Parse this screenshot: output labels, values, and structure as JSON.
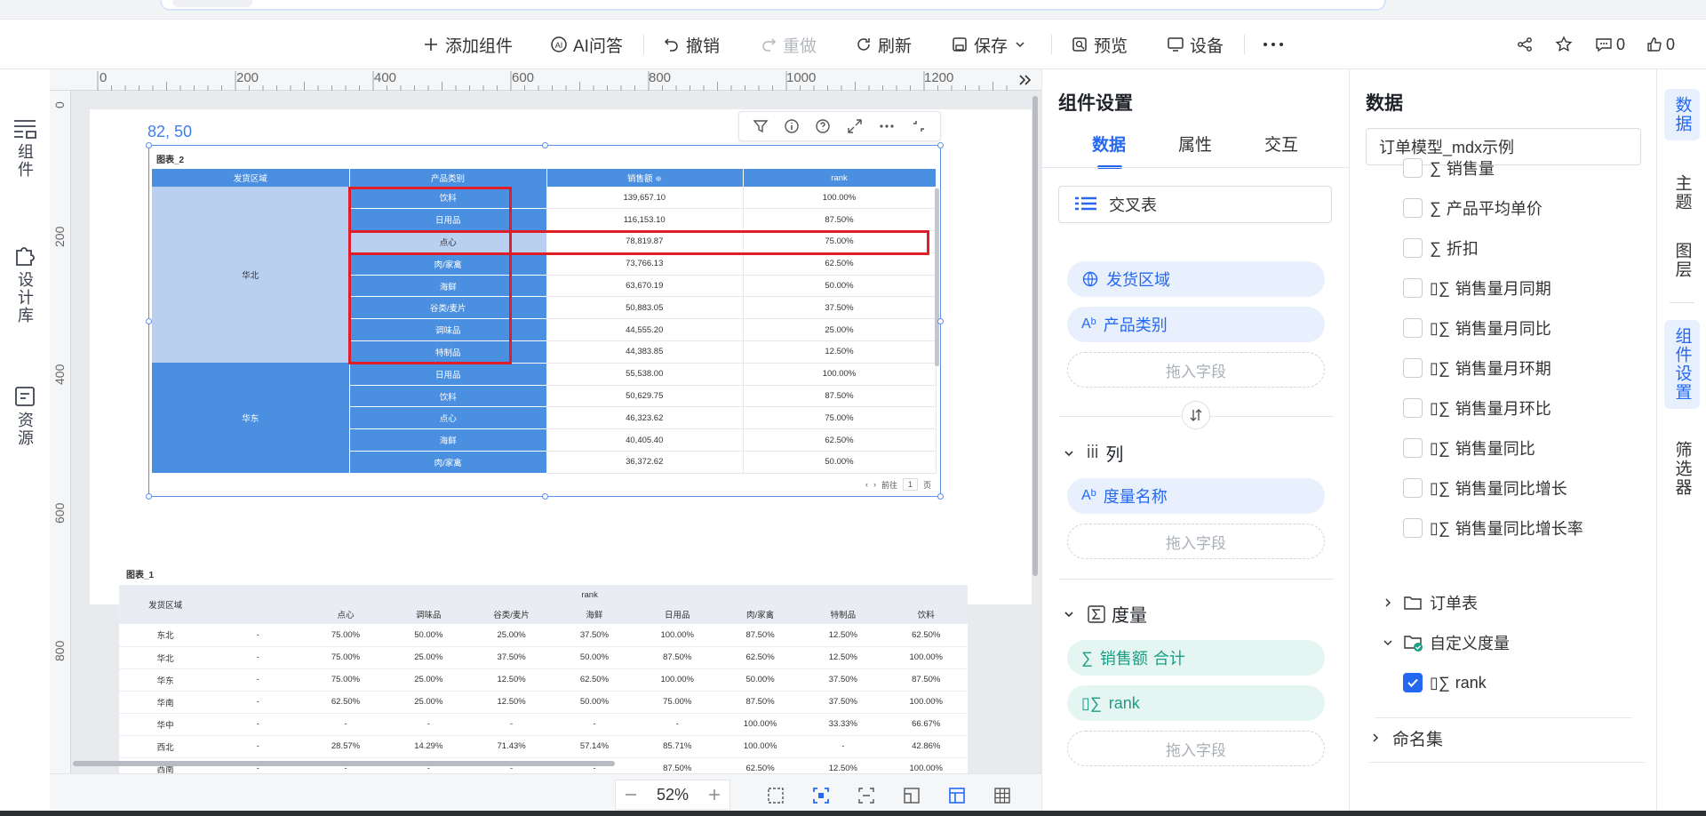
{
  "toolbar": {
    "add_component": "添加组件",
    "ai_qa": "AI问答",
    "undo": "撤销",
    "redo": "重做",
    "refresh": "刷新",
    "save": "保存",
    "preview": "预览",
    "device": "设备",
    "comments_count": "0",
    "likes_count": "0"
  },
  "leftnav": {
    "components": "组件",
    "design_library": "设计库",
    "resources": "资源"
  },
  "ruler": {
    "top": [
      "0",
      "200",
      "400",
      "600",
      "800",
      "1000",
      "1200"
    ],
    "left": [
      "0",
      "200",
      "400",
      "600",
      "800"
    ]
  },
  "canvas": {
    "selection_label": "82, 50",
    "zoom": "52%"
  },
  "chart2": {
    "title": "图表_2",
    "headers": [
      "发货区域",
      "产品类别",
      "销售额 ≑",
      "rank"
    ],
    "region1": "华北",
    "region2": "华东",
    "rows": [
      {
        "cat": "饮料",
        "sales": "139,657.10",
        "rank": "100.00%"
      },
      {
        "cat": "日用品",
        "sales": "116,153.10",
        "rank": "87.50%"
      },
      {
        "cat": "点心",
        "sales": "78,819.87",
        "rank": "75.00%"
      },
      {
        "cat": "肉/家禽",
        "sales": "73,766.13",
        "rank": "62.50%"
      },
      {
        "cat": "海鲜",
        "sales": "63,670.19",
        "rank": "50.00%"
      },
      {
        "cat": "谷类/麦片",
        "sales": "50,883.05",
        "rank": "37.50%"
      },
      {
        "cat": "调味品",
        "sales": "44,555.20",
        "rank": "25.00%"
      },
      {
        "cat": "特制品",
        "sales": "44,383.85",
        "rank": "12.50%"
      },
      {
        "cat": "日用品",
        "sales": "55,538.00",
        "rank": "100.00%"
      },
      {
        "cat": "饮料",
        "sales": "50,629.75",
        "rank": "87.50%"
      },
      {
        "cat": "点心",
        "sales": "46,323.62",
        "rank": "75.00%"
      },
      {
        "cat": "海鲜",
        "sales": "40,405.40",
        "rank": "62.50%"
      },
      {
        "cat": "肉/家禽",
        "sales": "36,372.62",
        "rank": "50.00%"
      }
    ],
    "pager": {
      "prefix": "前往",
      "page": "1",
      "suffix": "页"
    }
  },
  "chart1": {
    "title": "图表_1",
    "region_header": "发货区域",
    "group_header": "rank",
    "cols": [
      "",
      "点心",
      "调味品",
      "谷类/麦片",
      "海鲜",
      "日用品",
      "肉/家禽",
      "特制品",
      "饮料"
    ],
    "rows": [
      {
        "region": "东北",
        "vals": [
          "-",
          "75.00%",
          "50.00%",
          "25.00%",
          "37.50%",
          "100.00%",
          "87.50%",
          "12.50%",
          "62.50%"
        ]
      },
      {
        "region": "华北",
        "vals": [
          "-",
          "75.00%",
          "25.00%",
          "37.50%",
          "50.00%",
          "87.50%",
          "62.50%",
          "12.50%",
          "100.00%"
        ]
      },
      {
        "region": "华东",
        "vals": [
          "-",
          "75.00%",
          "25.00%",
          "12.50%",
          "62.50%",
          "100.00%",
          "50.00%",
          "37.50%",
          "87.50%"
        ]
      },
      {
        "region": "华南",
        "vals": [
          "-",
          "62.50%",
          "25.00%",
          "12.50%",
          "50.00%",
          "75.00%",
          "87.50%",
          "37.50%",
          "100.00%"
        ]
      },
      {
        "region": "华中",
        "vals": [
          "-",
          "-",
          "-",
          "-",
          "-",
          "-",
          "100.00%",
          "33.33%",
          "66.67%"
        ]
      },
      {
        "region": "西北",
        "vals": [
          "-",
          "28.57%",
          "14.29%",
          "71.43%",
          "57.14%",
          "85.71%",
          "100.00%",
          "-",
          "42.86%"
        ]
      },
      {
        "region": "西南",
        "vals": [
          "-",
          "-",
          "-",
          "-",
          "-",
          "87.50%",
          "62.50%",
          "12.50%",
          "100.00%"
        ]
      }
    ]
  },
  "props": {
    "title": "组件设置",
    "tabs": [
      "数据",
      "属性",
      "交互"
    ],
    "chart_type": "交叉表",
    "rows_fields": [
      "发货区域",
      "产品类别"
    ],
    "drop_placeholder": "拖入字段",
    "columns_label": "列",
    "columns_fields": [
      "度量名称"
    ],
    "measures_label": "度量",
    "measure_fields": [
      {
        "name": "销售额",
        "agg": "合计"
      },
      {
        "name": "rank",
        "agg": ""
      }
    ]
  },
  "data": {
    "title": "数据",
    "model": "订单模型_mdx示例",
    "fields": [
      "销售量",
      "产品平均单价",
      "折扣",
      "销售量月同期",
      "销售量月同比",
      "销售量月环期",
      "销售量月环比",
      "销售量同比",
      "销售量同比增长",
      "销售量同比增长率"
    ],
    "order_table": "订单表",
    "custom_measures": "自定义度量",
    "rank_field": "rank",
    "named_sets": "命名集"
  },
  "rightnav": [
    "数据",
    "主题",
    "图层",
    "组件设置",
    "筛选器"
  ],
  "colors": {
    "accent": "#2468f2",
    "table_blue": "#4a8fe0",
    "highlight": "#e11d27"
  }
}
